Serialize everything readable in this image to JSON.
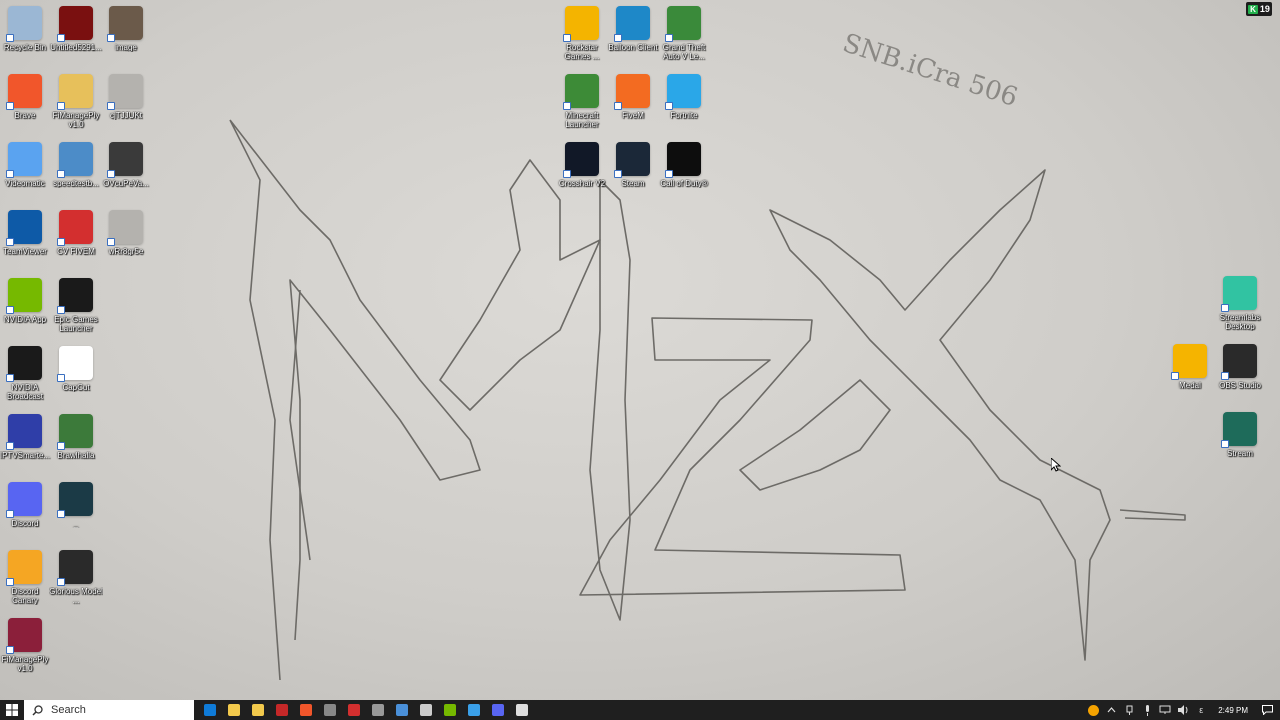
{
  "desktop": {
    "left_column_1": [
      {
        "label": "Recycle Bin",
        "icon": "recycle-bin-icon",
        "color": "#9bb7d4"
      },
      {
        "label": "Brave",
        "icon": "brave-icon",
        "color": "#f1562b"
      },
      {
        "label": "Videomatic",
        "icon": "videomatic-icon",
        "color": "#5aa3f0"
      },
      {
        "label": "TeamViewer",
        "icon": "teamviewer-icon",
        "color": "#0e5aa7"
      },
      {
        "label": "NVIDIA App",
        "icon": "nvidia-icon",
        "color": "#76b900"
      },
      {
        "label": "NVIDIA Broadcast",
        "icon": "nvidia-broadcast-icon",
        "color": "#1a1a1a"
      },
      {
        "label": "IPTVSmarte...",
        "icon": "iptv-icon",
        "color": "#2f3ea8"
      },
      {
        "label": "Discord",
        "icon": "discord-icon",
        "color": "#5865f2"
      },
      {
        "label": "Discord Canary",
        "icon": "discord-canary-icon",
        "color": "#f5a623"
      },
      {
        "label": "FiManagePly v1.0",
        "icon": "winrar-icon",
        "color": "#8b1f3a"
      }
    ],
    "left_column_2": [
      {
        "label": "Untitled5291...",
        "icon": "file-icon",
        "color": "#7a1010"
      },
      {
        "label": "FiManagePly v1.0",
        "icon": "folder-icon",
        "color": "#e7c05b"
      },
      {
        "label": "speedtestb...",
        "icon": "computer-icon",
        "color": "#4c8cc8"
      },
      {
        "label": "CV FIVEM",
        "icon": "pdf-icon",
        "color": "#d32f2f"
      },
      {
        "label": "Epic Games Launcher",
        "icon": "epic-games-icon",
        "color": "#1a1a1a"
      },
      {
        "label": "CapCut",
        "icon": "capcut-icon",
        "color": "#ffffff"
      },
      {
        "label": "Brawlhalla",
        "icon": "brawlhalla-icon",
        "color": "#3c7a3a"
      },
      {
        "label": "_",
        "icon": "app-icon",
        "color": "#1b3a46"
      },
      {
        "label": "Glorious Model ...",
        "icon": "mouse-icon",
        "color": "#2a2a2a"
      }
    ],
    "left_column_3": [
      {
        "label": "image",
        "icon": "image-icon",
        "color": "#6b5a4a"
      },
      {
        "label": "cjTJJUKt",
        "icon": "image-icon",
        "color": "#b4b2ae"
      },
      {
        "label": "OVcuPeVa...",
        "icon": "image-icon",
        "color": "#3a3a3a"
      },
      {
        "label": "wRr8gr5e",
        "icon": "image-icon",
        "color": "#b4b2ae"
      }
    ],
    "center_grid": [
      {
        "label": "Rockstar Games ...",
        "icon": "rockstar-icon",
        "color": "#f4b400"
      },
      {
        "label": "Balloon Client",
        "icon": "balloon-client-icon",
        "color": "#1e88c8"
      },
      {
        "label": "Grand Theft Auto V Le...",
        "icon": "gta-icon",
        "color": "#3a8a3a"
      },
      {
        "label": "Minecraft Launcher",
        "icon": "minecraft-icon",
        "color": "#3d8b37"
      },
      {
        "label": "FiveM",
        "icon": "fivem-icon",
        "color": "#f36b21"
      },
      {
        "label": "Fortnite",
        "icon": "fortnite-icon",
        "color": "#2aa7e8"
      },
      {
        "label": "Crosshair V2",
        "icon": "crosshair-icon",
        "color": "#111827"
      },
      {
        "label": "Steam",
        "icon": "steam-icon",
        "color": "#1b2838"
      },
      {
        "label": "Call of Duty®",
        "icon": "call-of-duty-icon",
        "color": "#0d0d0d"
      }
    ],
    "right_column": [
      {
        "label": "Streamlabs Desktop",
        "icon": "streamlabs-icon",
        "color": "#31c3a2"
      },
      {
        "label": "Medal",
        "icon": "medal-icon",
        "color": "#f5b400"
      },
      {
        "label": "OBS Studio",
        "icon": "obs-icon",
        "color": "#2a2a2a"
      },
      {
        "label": "Stream",
        "icon": "stream-icon",
        "color": "#1e6b5a"
      }
    ],
    "badge_count": "19",
    "badge_letter": "K",
    "wallpaper_text": "SNB.iCra 506"
  },
  "taskbar": {
    "search_placeholder": "Search",
    "apps": [
      {
        "name": "edge-icon",
        "color": "#0f7bd8"
      },
      {
        "name": "file-explorer-icon",
        "color": "#f2c94c"
      },
      {
        "name": "calendar-icon",
        "color": "#f2c94c"
      },
      {
        "name": "news-icon",
        "color": "#c62828"
      },
      {
        "name": "brave-icon",
        "color": "#f1562b"
      },
      {
        "name": "crosshair-icon",
        "color": "#888888"
      },
      {
        "name": "tool-icon",
        "color": "#d32f2f"
      },
      {
        "name": "overwolf-icon",
        "color": "#999999"
      },
      {
        "name": "steam-icon",
        "color": "#4a90d9"
      },
      {
        "name": "pen-icon",
        "color": "#cccccc"
      },
      {
        "name": "nvidia-icon",
        "color": "#76b900"
      },
      {
        "name": "snipping-icon",
        "color": "#3aa0e8"
      },
      {
        "name": "discord-icon",
        "color": "#5865f2"
      },
      {
        "name": "settings-icon",
        "color": "#dddddd"
      }
    ],
    "clock_time": "2:49 PM",
    "tray_lang": "ε"
  }
}
